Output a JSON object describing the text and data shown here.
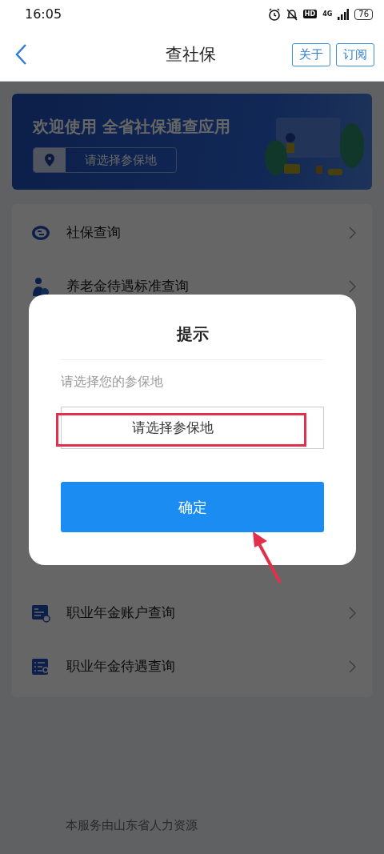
{
  "status_bar": {
    "time": "16:05",
    "battery": "76",
    "network": "4G",
    "hd": "HD"
  },
  "nav": {
    "title": "查社保",
    "buttons": [
      "关于",
      "订阅"
    ]
  },
  "banner": {
    "title": "欢迎使用 全省社保通查应用",
    "location_placeholder": "请选择参保地"
  },
  "menu": {
    "items": [
      {
        "label": "社保查询",
        "kind": "si-logo"
      },
      {
        "label": "养老金待遇标准查询",
        "kind": "person"
      },
      {
        "label": "职业年金账户查询",
        "kind": "card"
      },
      {
        "label": "职业年金待遇查询",
        "kind": "list"
      }
    ]
  },
  "footer": {
    "text": "本服务由山东省人力资源"
  },
  "dialog": {
    "title": "提示",
    "label": "请选择您的参保地",
    "select_value": "请选择参保地",
    "confirm": "确定"
  }
}
